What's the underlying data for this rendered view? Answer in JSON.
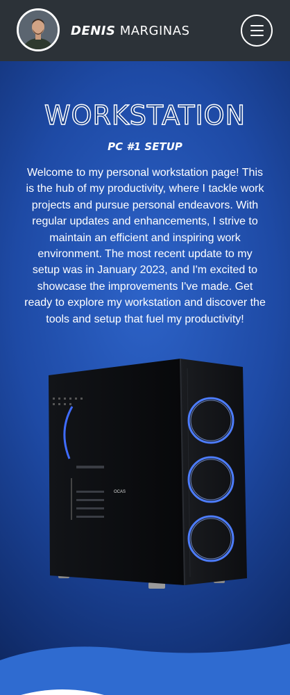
{
  "header": {
    "name_first": "DENIS",
    "name_last": "MARGINAS",
    "avatar_icon": "avatar-photo",
    "menu_icon": "hamburger-menu-icon"
  },
  "hero": {
    "title": "WORKSTATION",
    "subtitle": "PC #1 SETUP",
    "intro": "Welcome to my personal workstation page! This is the hub of my productivity, where I tackle work projects and pursue personal endeavors. With regular updates and enhancements, I strive to maintain an efficient and inspiring work environment. The most recent update to my setup was in January 2023, and I'm excited to showcase the improvements I've made. Get ready to explore my workstation and discover the tools and setup that fuel my productivity!"
  },
  "image": {
    "case_badge": "OCAS"
  },
  "colors": {
    "header_bg": "#2c3238",
    "page_bg": "#1e4aa5",
    "wave": "#2f6bd0"
  }
}
